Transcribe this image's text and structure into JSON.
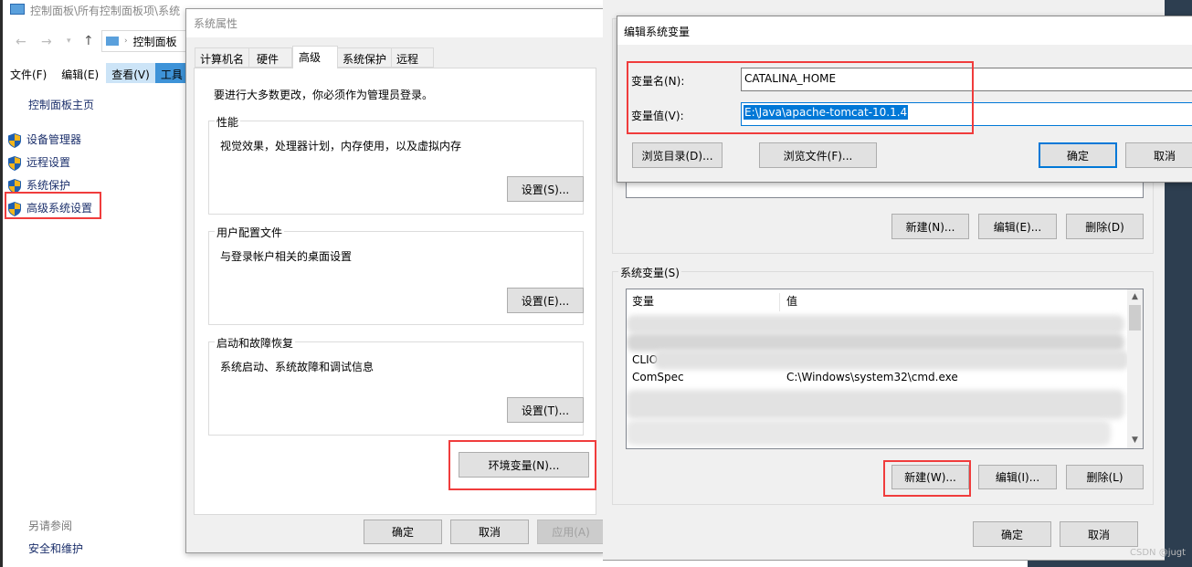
{
  "control_panel": {
    "title": "控制面板\\所有控制面板项\\系统",
    "breadcrumb": "控制面板",
    "menu": [
      "文件(F)",
      "编辑(E)",
      "查看(V)",
      "工具"
    ],
    "home": "控制面板主页",
    "links": [
      {
        "label": "设备管理器",
        "icon": "shield-icon"
      },
      {
        "label": "远程设置",
        "icon": "shield-icon"
      },
      {
        "label": "系统保护",
        "icon": "shield-icon"
      },
      {
        "label": "高级系统设置",
        "icon": "shield-icon"
      }
    ],
    "see_also": "另请参阅",
    "security": "安全和维护"
  },
  "sys_props": {
    "title": "系统属性",
    "tabs": [
      "计算机名",
      "硬件",
      "高级",
      "系统保护",
      "远程"
    ],
    "active_tab": "高级",
    "admin_note": "要进行大多数更改，你必须作为管理员登录。",
    "groups": [
      {
        "legend": "性能",
        "desc": "视觉效果，处理器计划，内存使用，以及虚拟内存",
        "button": "设置(S)..."
      },
      {
        "legend": "用户配置文件",
        "desc": "与登录帐户相关的桌面设置",
        "button": "设置(E)..."
      },
      {
        "legend": "启动和故障恢复",
        "desc": "系统启动、系统故障和调试信息",
        "button": "设置(T)..."
      }
    ],
    "env_button": "环境变量(N)...",
    "ok": "确定",
    "cancel": "取消",
    "apply": "应用(A)"
  },
  "env_vars": {
    "user_buttons": [
      "新建(N)...",
      "编辑(E)...",
      "删除(D)"
    ],
    "system_legend": "系统变量(S)",
    "columns": [
      "变量",
      "值"
    ],
    "rows": [
      {
        "name": "CLIO",
        "value": ""
      },
      {
        "name": "ComSpec",
        "value": "C:\\Windows\\system32\\cmd.exe"
      }
    ],
    "system_buttons": [
      "新建(W)...",
      "编辑(I)...",
      "删除(L)"
    ],
    "ok": "确定",
    "cancel": "取消"
  },
  "edit_dialog": {
    "title": "编辑系统变量",
    "name_label": "变量名(N):",
    "name_value": "CATALINA_HOME",
    "value_label": "变量值(V):",
    "value_value": "E:\\Java\\apache-tomcat-10.1.4",
    "browse_dir": "浏览目录(D)...",
    "browse_file": "浏览文件(F)...",
    "ok": "确定",
    "cancel": "取消"
  },
  "watermark": "CSDN @jugt",
  "colors": {
    "accent": "#0078d7",
    "highlight_box": "#f03c3c",
    "dark_bg": "#2d3e50"
  }
}
